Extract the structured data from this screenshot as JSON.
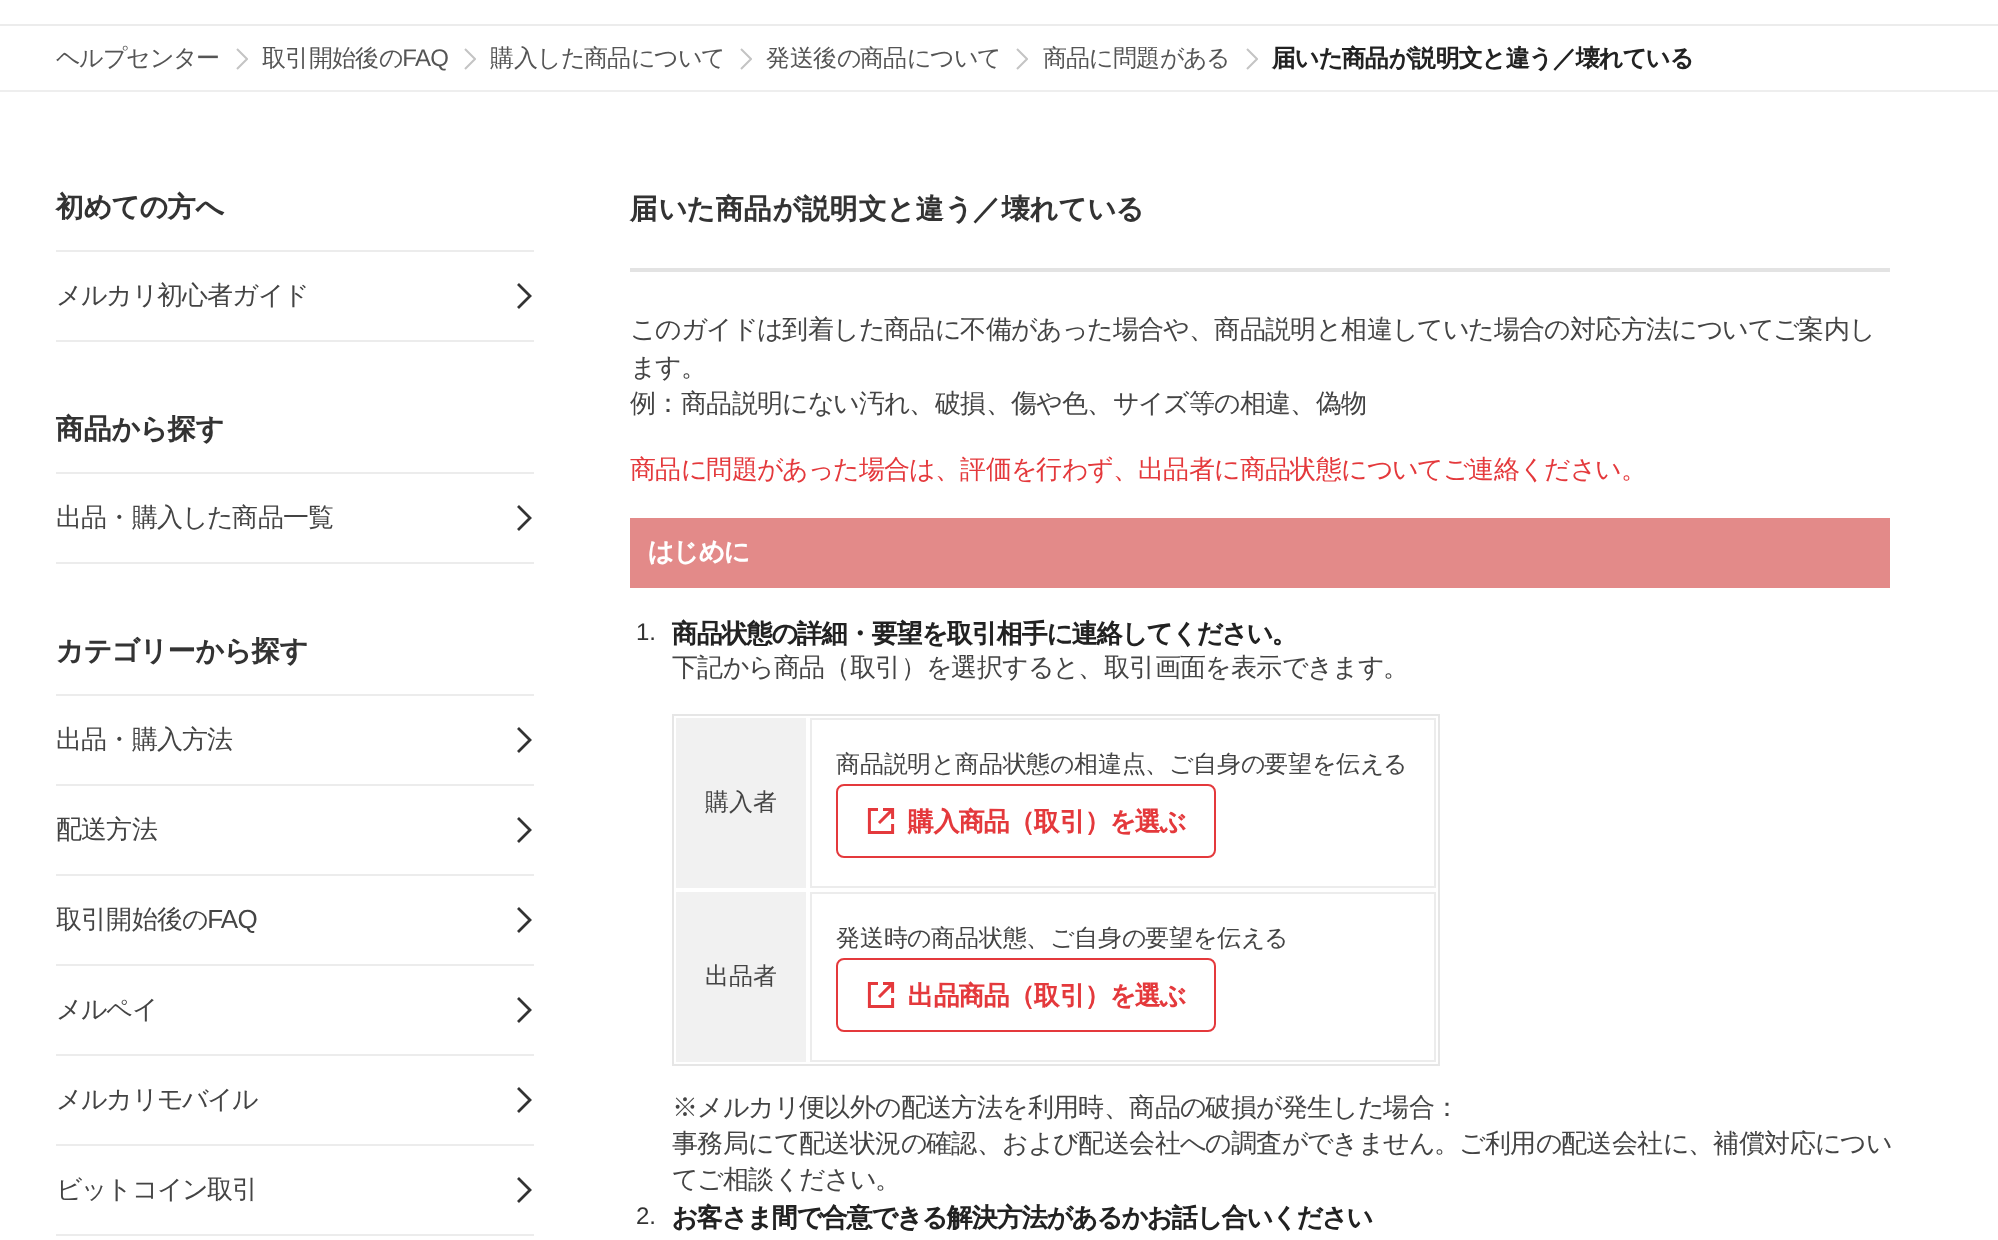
{
  "breadcrumb": [
    {
      "label": "ヘルプセンター",
      "current": false
    },
    {
      "label": "取引開始後のFAQ",
      "current": false
    },
    {
      "label": "購入した商品について",
      "current": false
    },
    {
      "label": "発送後の商品について",
      "current": false
    },
    {
      "label": "商品に問題がある",
      "current": false
    },
    {
      "label": "届いた商品が説明文と違う／壊れている",
      "current": true
    }
  ],
  "sidebar": {
    "sections": [
      {
        "heading": "初めての方へ",
        "items": [
          "メルカリ初心者ガイド"
        ]
      },
      {
        "heading": "商品から探す",
        "items": [
          "出品・購入した商品一覧"
        ]
      },
      {
        "heading": "カテゴリーから探す",
        "items": [
          "出品・購入方法",
          "配送方法",
          "取引開始後のFAQ",
          "メルペイ",
          "メルカリモバイル",
          "ビットコイン取引"
        ]
      }
    ]
  },
  "article": {
    "title": "届いた商品が説明文と違う／壊れている",
    "intro": "このガイドは到着した商品に不備があった場合や、商品説明と相違していた場合の対応方法についてご案内します。",
    "example": "例：商品説明にない汚れ、破損、傷や色、サイズ等の相違、偽物",
    "warning": "商品に問題があった場合は、評価を行わず、出品者に商品状態についてご連絡ください。",
    "section_heading": "はじめに",
    "steps": [
      {
        "number": "1.",
        "title": "商品状態の詳細・要望を取引相手に連絡してください。",
        "text": "下記から商品（取引）を選択すると、取引画面を表示できます。",
        "table": [
          {
            "role": "購入者",
            "description": "商品説明と商品状態の相違点、ご自身の要望を伝える",
            "button": "購入商品（取引）を選ぶ"
          },
          {
            "role": "出品者",
            "description": "発送時の商品状態、ご自身の要望を伝える",
            "button": "出品商品（取引）を選ぶ"
          }
        ],
        "notes": [
          "※メルカリ便以外の配送方法を利用時、商品の破損が発生した場合：",
          "事務局にて配送状況の確認、および配送会社への調査ができません。ご利用の配送会社に、補償対応についてご相談ください。"
        ]
      },
      {
        "number": "2.",
        "title": "お客さま間で合意できる解決方法があるかお話し合いください"
      }
    ]
  }
}
